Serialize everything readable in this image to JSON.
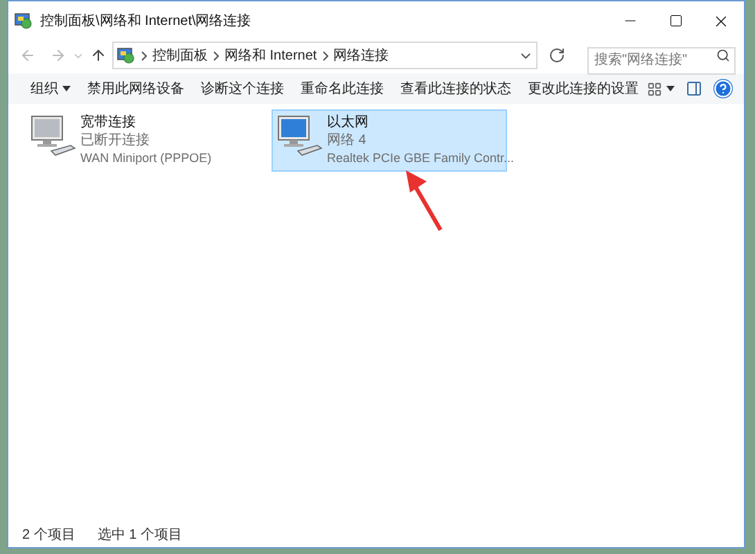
{
  "window": {
    "title": "控制面板\\网络和 Internet\\网络连接"
  },
  "address": {
    "segments": [
      "控制面板",
      "网络和 Internet",
      "网络连接"
    ]
  },
  "search": {
    "placeholder": "搜索\"网络连接\""
  },
  "toolbar": {
    "items": [
      {
        "label": "组织",
        "dropdown": true
      },
      {
        "label": "禁用此网络设备",
        "dropdown": false
      },
      {
        "label": "诊断这个连接",
        "dropdown": false
      },
      {
        "label": "重命名此连接",
        "dropdown": false
      },
      {
        "label": "查看此连接的状态",
        "dropdown": false
      },
      {
        "label": "更改此连接的设置",
        "dropdown": false
      }
    ]
  },
  "connections": [
    {
      "kind": "broadband",
      "name": "宽带连接",
      "status": "已断开连接",
      "device": "WAN Miniport (PPPOE)",
      "selected": false
    },
    {
      "kind": "ethernet",
      "name": "以太网",
      "status": "网络 4",
      "device": "Realtek PCIe GBE Family Contr...",
      "selected": true
    }
  ],
  "status_bar": {
    "count": "2 个项目",
    "selection": "选中 1 个项目"
  }
}
